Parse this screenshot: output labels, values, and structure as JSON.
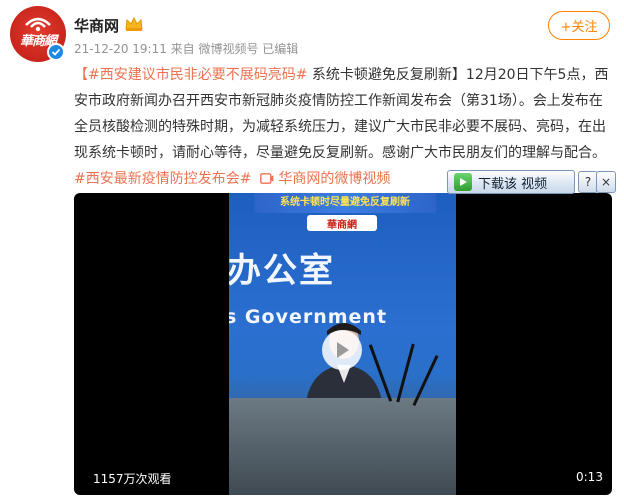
{
  "user": {
    "name": "华商网",
    "avatar_text": "華商網",
    "meta": "21-12-20 19:11  来自 微博视频号 已编辑"
  },
  "follow": {
    "label": "+关注"
  },
  "post": {
    "tag1": "【#西安建议市民非必要不展码亮码#",
    "text1": " 系统卡顿避免反复刷新】12月20日下午5点，西安市政府新闻办召开西安市新冠肺炎疫情防控工作新闻发布会（第31场）。会上发布在全员核酸检测的特殊时期，为减轻系统压力，建议广大市民非必要不展码、亮码，在出现系统卡顿时，请耐心等待，尽量避免反复刷新。感谢广大市民朋友们的理解与配合。",
    "tag2": "#西安最新疫情防控发布会#",
    "video_link": " 华商网的微博视频"
  },
  "video": {
    "banner": "系统卡顿时尽量避免反复刷新",
    "logo": "華商網",
    "hall_text": "办公室",
    "gov_text": "s Government",
    "views": "1157万次观看",
    "duration": "0:13"
  },
  "download": {
    "label": "下载该 视频",
    "help": "?",
    "close": "×"
  },
  "colors": {
    "accent": "#eb7350",
    "follow": "#ff8200",
    "brand_red": "#c8251c"
  }
}
